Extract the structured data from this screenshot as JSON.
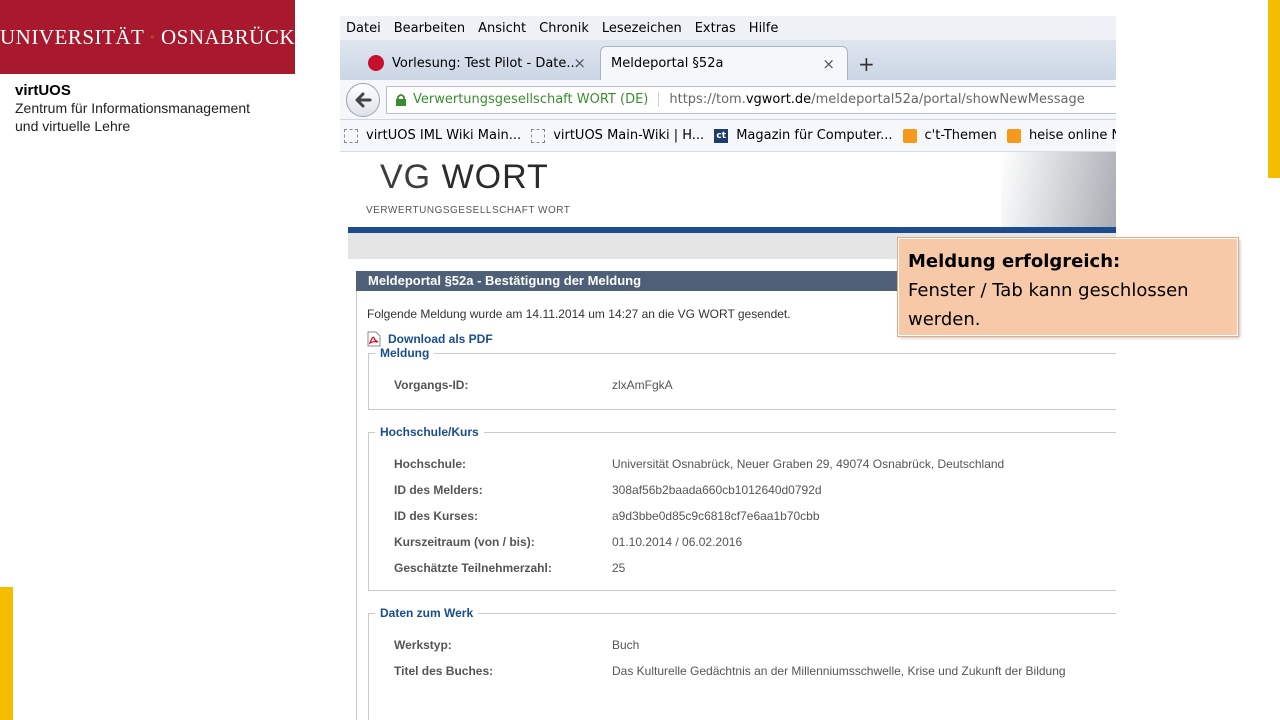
{
  "branding": {
    "logo_left": "UNIVERSITÄT",
    "logo_right": "OSNABRÜCK",
    "org_name": "virtUOS",
    "org_line1": "Zentrum für Informationsmanagement",
    "org_line2": "und virtuelle Lehre",
    "brand_color": "#a8192e",
    "accent_color": "#f5bd00"
  },
  "browser": {
    "menu": [
      "Datei",
      "Bearbeiten",
      "Ansicht",
      "Chronik",
      "Lesezeichen",
      "Extras",
      "Hilfe"
    ],
    "tabs": [
      {
        "label": "Vorlesung: Test Pilot - Date...",
        "icon": "test-pilot-icon"
      },
      {
        "label": "Meldeportal §52a",
        "active": true
      }
    ],
    "tab_close": "×",
    "new_tab": "+",
    "url": {
      "identity": "Verwertungsgesellschaft WORT (DE)",
      "prefix": "https://tom.",
      "host": "vgwort.de",
      "path": "/meldeportal52a/portal/showNewMessage"
    },
    "bookmarks": [
      {
        "label": "virtUOS IML Wiki Main...",
        "icon": "page-icon"
      },
      {
        "label": "virtUOS Main-Wiki | H...",
        "icon": "page-icon"
      },
      {
        "label": "Magazin für Computer...",
        "icon": "ct-icon"
      },
      {
        "label": "c't-Themen",
        "icon": "rss-icon"
      },
      {
        "label": "heise online New",
        "icon": "rss-icon"
      }
    ]
  },
  "vgwort": {
    "logo_vg": "VG",
    "logo_wort": "WORT",
    "logo_sub": "VERWERTUNGSGESELLSCHAFT WORT",
    "panel_title": "Meldeportal §52a - Bestätigung der Meldung",
    "confirm_text": "Folgende Meldung wurde am 14.11.2014 um 14:27 an die VG WORT gesendet.",
    "pdf_link": "Download als PDF",
    "sections": {
      "meldung": {
        "legend": "Meldung",
        "rows": [
          {
            "label": "Vorgangs-ID:",
            "value": "zlxAmFgkA"
          }
        ]
      },
      "hochschule": {
        "legend": "Hochschule/Kurs",
        "rows": [
          {
            "label": "Hochschule:",
            "value": "Universität Osnabrück, Neuer Graben 29, 49074 Osnabrück, Deutschland"
          },
          {
            "label": "ID des Melders:",
            "value": "308af56b2baada660cb1012640d0792d"
          },
          {
            "label": "ID des Kurses:",
            "value": "a9d3bbe0d85c9c6818cf7e6aa1b70cbb"
          },
          {
            "label": "Kurszeitraum (von / bis):",
            "value": "01.10.2014 / 06.02.2016"
          },
          {
            "label": "Geschätzte Teilnehmerzahl:",
            "value": "25"
          }
        ]
      },
      "werk": {
        "legend": "Daten zum Werk",
        "rows": [
          {
            "label": "Werkstyp:",
            "value": "Buch"
          },
          {
            "label": "Titel des Buches:",
            "value": "Das Kulturelle Gedächtnis an der Millenniumsschwelle, Krise und Zukunft der Bildung"
          }
        ]
      }
    }
  },
  "note": {
    "title": "Meldung erfolgreich:",
    "text": "Fenster / Tab kann geschlossen werden."
  }
}
